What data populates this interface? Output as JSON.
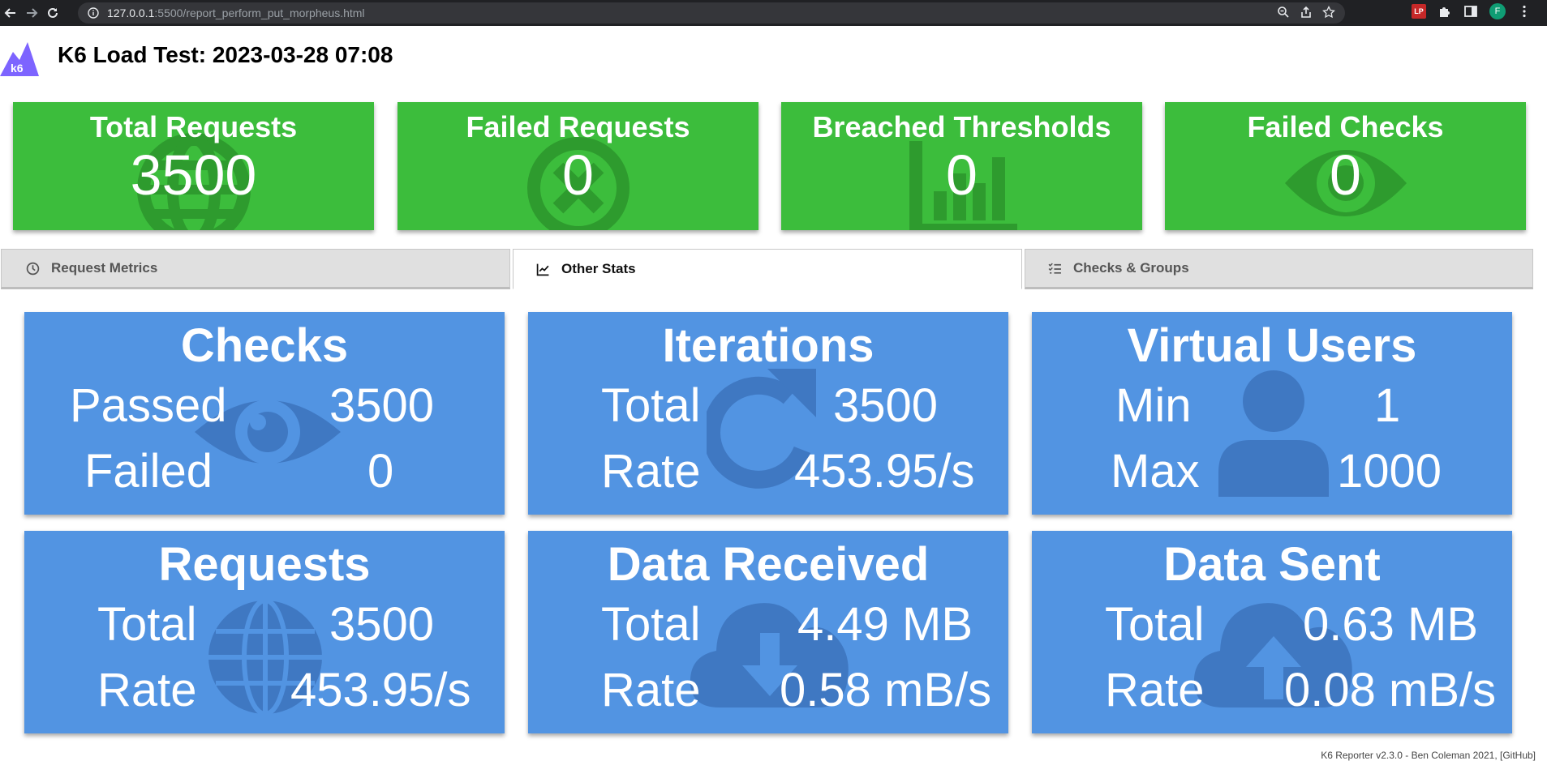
{
  "browser": {
    "url_host": "127.0.0.1",
    "url_path": ":5500/report_perform_put_morpheus.html",
    "profile_initial": "F",
    "extension_badge": "LP"
  },
  "header": {
    "logo_text": "k6",
    "title": "K6 Load Test: 2023-03-28 07:08"
  },
  "summary": [
    {
      "title": "Total Requests",
      "value": "3500",
      "icon": "globe-icon"
    },
    {
      "title": "Failed Requests",
      "value": "0",
      "icon": "x-circle-icon"
    },
    {
      "title": "Breached Thresholds",
      "value": "0",
      "icon": "chart-icon"
    },
    {
      "title": "Failed Checks",
      "value": "0",
      "icon": "eye-icon"
    }
  ],
  "tabs": [
    {
      "label": "Request Metrics",
      "icon": "clock-icon"
    },
    {
      "label": "Other Stats",
      "icon": "line-chart-icon",
      "active": true
    },
    {
      "label": "Checks & Groups",
      "icon": "checklist-icon"
    }
  ],
  "cards": {
    "checks": {
      "title": "Checks",
      "row1_label": "Passed",
      "row1_value": "3500",
      "row2_label": "Failed",
      "row2_value": "0",
      "icon": "eye-icon"
    },
    "iterations": {
      "title": "Iterations",
      "row1_label": "Total",
      "row1_value": "3500",
      "row2_label": "Rate",
      "row2_value": "453.95/s",
      "icon": "redo-icon"
    },
    "virtual_users": {
      "title": "Virtual Users",
      "row1_label": "Min",
      "row1_value": "1",
      "row2_label": "Max",
      "row2_value": "1000",
      "icon": "user-icon"
    },
    "requests": {
      "title": "Requests",
      "row1_label": "Total",
      "row1_value": "3500",
      "row2_label": "Rate",
      "row2_value": "453.95/s",
      "icon": "globe-icon"
    },
    "data_received": {
      "title": "Data Received",
      "row1_label": "Total",
      "row1_value": "4.49 MB",
      "row2_label": "Rate",
      "row2_value": "0.58 mB/s",
      "icon": "cloud-download-icon"
    },
    "data_sent": {
      "title": "Data Sent",
      "row1_label": "Total",
      "row1_value": "0.63 MB",
      "row2_label": "Rate",
      "row2_value": "0.08 mB/s",
      "icon": "cloud-upload-icon"
    }
  },
  "footer": {
    "text": "K6 Reporter v2.3.0 - Ben Coleman 2021, [GitHub]"
  },
  "colors": {
    "summary_green": "#3cbd3c",
    "card_blue": "#5294e2",
    "icon_overlay_green": "#2e9b2e",
    "icon_overlay_blue": "#3f78c2"
  }
}
